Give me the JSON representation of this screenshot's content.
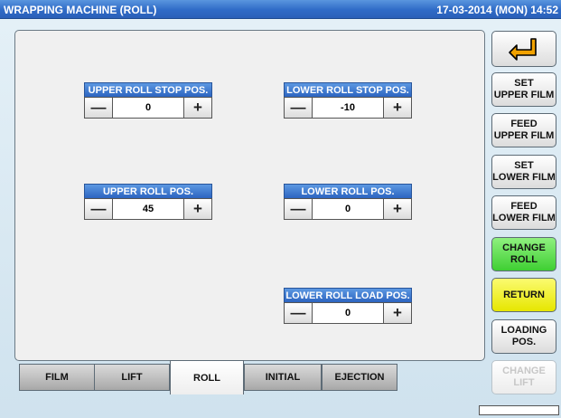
{
  "header": {
    "title": "WRAPPING MACHINE (ROLL)",
    "datetime": "17-03-2014 (MON)  14:52"
  },
  "controls": {
    "upper_roll_stop": {
      "label": "UPPER ROLL STOP POS.",
      "value": "0",
      "minus": "—",
      "plus": "+"
    },
    "lower_roll_stop": {
      "label": "LOWER ROLL STOP POS.",
      "value": "-10",
      "minus": "—",
      "plus": "+"
    },
    "upper_roll_pos": {
      "label": "UPPER ROLL POS.",
      "value": "45",
      "minus": "—",
      "plus": "+"
    },
    "lower_roll_pos": {
      "label": "LOWER ROLL POS.",
      "value": "0",
      "minus": "—",
      "plus": "+"
    },
    "lower_roll_load": {
      "label": "LOWER ROLL LOAD POS.",
      "value": "0",
      "minus": "—",
      "plus": "+"
    }
  },
  "side_buttons": {
    "back_icon": "return-arrow-icon",
    "set_upper_film": [
      "SET",
      "UPPER FILM"
    ],
    "feed_upper_film": [
      "FEED",
      "UPPER FILM"
    ],
    "set_lower_film": [
      "SET",
      "LOWER FILM"
    ],
    "feed_lower_film": [
      "FEED",
      "LOWER FILM"
    ],
    "change_roll": [
      "CHANGE",
      "ROLL"
    ],
    "return": "RETURN",
    "loading_pos": [
      "LOADING",
      "POS."
    ],
    "change_lift": [
      "CHANGE",
      "LIFT"
    ]
  },
  "tabs": [
    "FILM",
    "LIFT",
    "ROLL",
    "INITIAL",
    "EJECTION"
  ],
  "active_tab": "ROLL",
  "colors": {
    "title_blue": "#2f6bc7",
    "label_blue": "#2c64c0",
    "green_button": "#3fcf33",
    "yellow_button": "#e6e600",
    "arrow_orange": "#f2a200"
  }
}
